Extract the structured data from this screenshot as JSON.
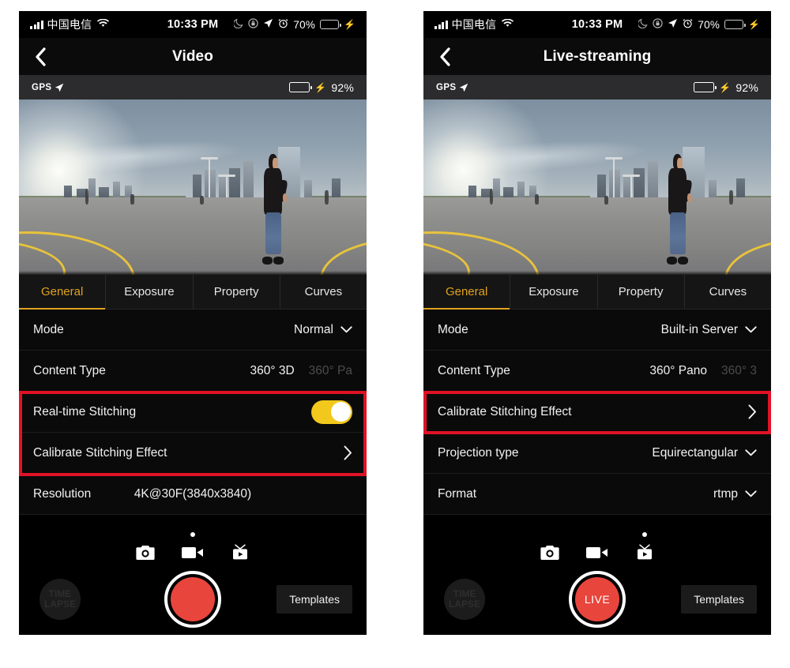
{
  "status_bar": {
    "carrier": "中国电信",
    "time": "10:33 PM",
    "battery_percent": "70%",
    "icons": [
      "signal-bars-icon",
      "wifi-icon",
      "moon-icon",
      "rotation-lock-icon",
      "location-arrow-icon",
      "alarm-clock-icon",
      "battery-icon",
      "charging-bolt-icon"
    ]
  },
  "gps_bar": {
    "label": "GPS",
    "battery_percent": "92%"
  },
  "colors": {
    "accent_gold": "#e0a31d",
    "toggle_on": "#f2c81c",
    "annotation_red": "#e01225",
    "shutter_red": "#e8453c",
    "battery_green": "#3ad352"
  },
  "left_phone": {
    "nav": {
      "title": "Video",
      "back_label": "back"
    },
    "tabs": [
      {
        "label": "General",
        "active": true
      },
      {
        "label": "Exposure",
        "active": false
      },
      {
        "label": "Property",
        "active": false
      },
      {
        "label": "Curves",
        "active": false
      }
    ],
    "rows": {
      "mode_label": "Mode",
      "mode_value": "Normal",
      "content_type_label": "Content Type",
      "content_type_selected": "360° 3D",
      "content_type_next": "360° Pa",
      "realtime_stitching_label": "Real-time Stitching",
      "realtime_stitching_state": "on",
      "calibrate_label": "Calibrate Stitching Effect",
      "resolution_label": "Resolution",
      "resolution_value": "4K@30F(3840x3840)"
    },
    "controls": {
      "timelapse_line1": "TIME",
      "timelapse_line2": "LAPSE",
      "shutter_label": "",
      "templates_label": "Templates",
      "active_mode": "video"
    }
  },
  "right_phone": {
    "nav": {
      "title": "Live-streaming",
      "back_label": "back"
    },
    "tabs": [
      {
        "label": "General",
        "active": true
      },
      {
        "label": "Exposure",
        "active": false
      },
      {
        "label": "Property",
        "active": false
      },
      {
        "label": "Curves",
        "active": false
      }
    ],
    "rows": {
      "mode_label": "Mode",
      "mode_value": "Built-in Server",
      "content_type_label": "Content Type",
      "content_type_selected": "360° Pano",
      "content_type_next": "360° 3",
      "calibrate_label": "Calibrate Stitching Effect",
      "projection_label": "Projection type",
      "projection_value": "Equirectangular",
      "format_label": "Format",
      "format_value": "rtmp"
    },
    "controls": {
      "timelapse_line1": "TIME",
      "timelapse_line2": "LAPSE",
      "shutter_label": "LIVE",
      "templates_label": "Templates",
      "active_mode": "live"
    }
  }
}
